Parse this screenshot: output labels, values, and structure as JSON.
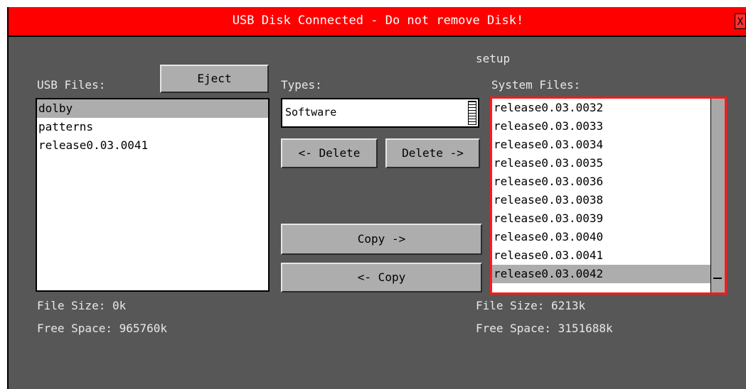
{
  "title": "USB Disk Connected - Do not remove Disk!",
  "close_glyph": "X",
  "usb": {
    "label": "USB Files:",
    "eject_label": "Eject",
    "files": [
      "dolby",
      "patterns",
      "release0.03.0041"
    ],
    "selected_index": 0,
    "file_size": "File Size: 0k",
    "free_space": "Free Space: 965760k"
  },
  "types": {
    "label": "Types:",
    "value": "Software",
    "delete_left": "<- Delete",
    "delete_right": "Delete ->",
    "copy_right": "Copy ->",
    "copy_left": "<- Copy"
  },
  "system": {
    "setup_label": "setup",
    "label": "System Files:",
    "files": [
      "release0.03.0032",
      "release0.03.0033",
      "release0.03.0034",
      "release0.03.0035",
      "release0.03.0036",
      "release0.03.0038",
      "release0.03.0039",
      "release0.03.0040",
      "release0.03.0041",
      "release0.03.0042"
    ],
    "selected_index": 9,
    "file_size": "File Size: 6213k",
    "free_space": "Free Space: 3151688k"
  },
  "colors": {
    "titlebar": "#ff0000",
    "panel": "#575757",
    "button": "#adadad",
    "focus": "#ff1a1a"
  }
}
